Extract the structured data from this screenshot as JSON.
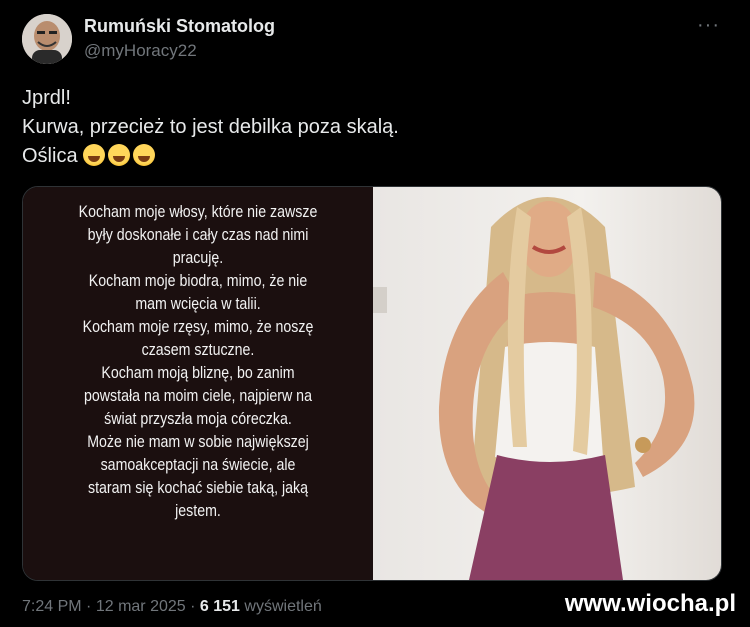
{
  "author": {
    "name": "Rumuński Stomatolog",
    "handle": "@myHoracy22",
    "more_icon": "more-horizontal-icon"
  },
  "tweet": {
    "lines": [
      "Jprdl!",
      "Kurwa, przecież to jest debilka poza skalą.",
      "Oślica"
    ],
    "emoji": "face-with-tears-of-joy",
    "emoji_count": 3
  },
  "story": {
    "lines": [
      "Kocham moje włosy, które nie zawsze",
      "były doskonałe i cały czas nad nimi",
      "pracuję.",
      "Kocham moje biodra, mimo, że nie",
      "mam wcięcia w talii.",
      "Kocham moje rzęsy, mimo, że noszę",
      "czasem sztuczne.",
      "Kocham moją bliznę, bo zanim",
      "powstała na moim ciele, najpierw na",
      "świat przyszła moja córeczka.",
      "Może nie mam w sobie największej",
      "samoakceptacji na świecie, ale",
      "staram się kochać siebie taką, jaką",
      "jestem."
    ]
  },
  "meta": {
    "time": "7:24 PM",
    "sep": "·",
    "date": "12 mar 2025",
    "views_count": "6 151",
    "views_label": "wyświetleń"
  },
  "watermark": "www.wiocha.pl"
}
